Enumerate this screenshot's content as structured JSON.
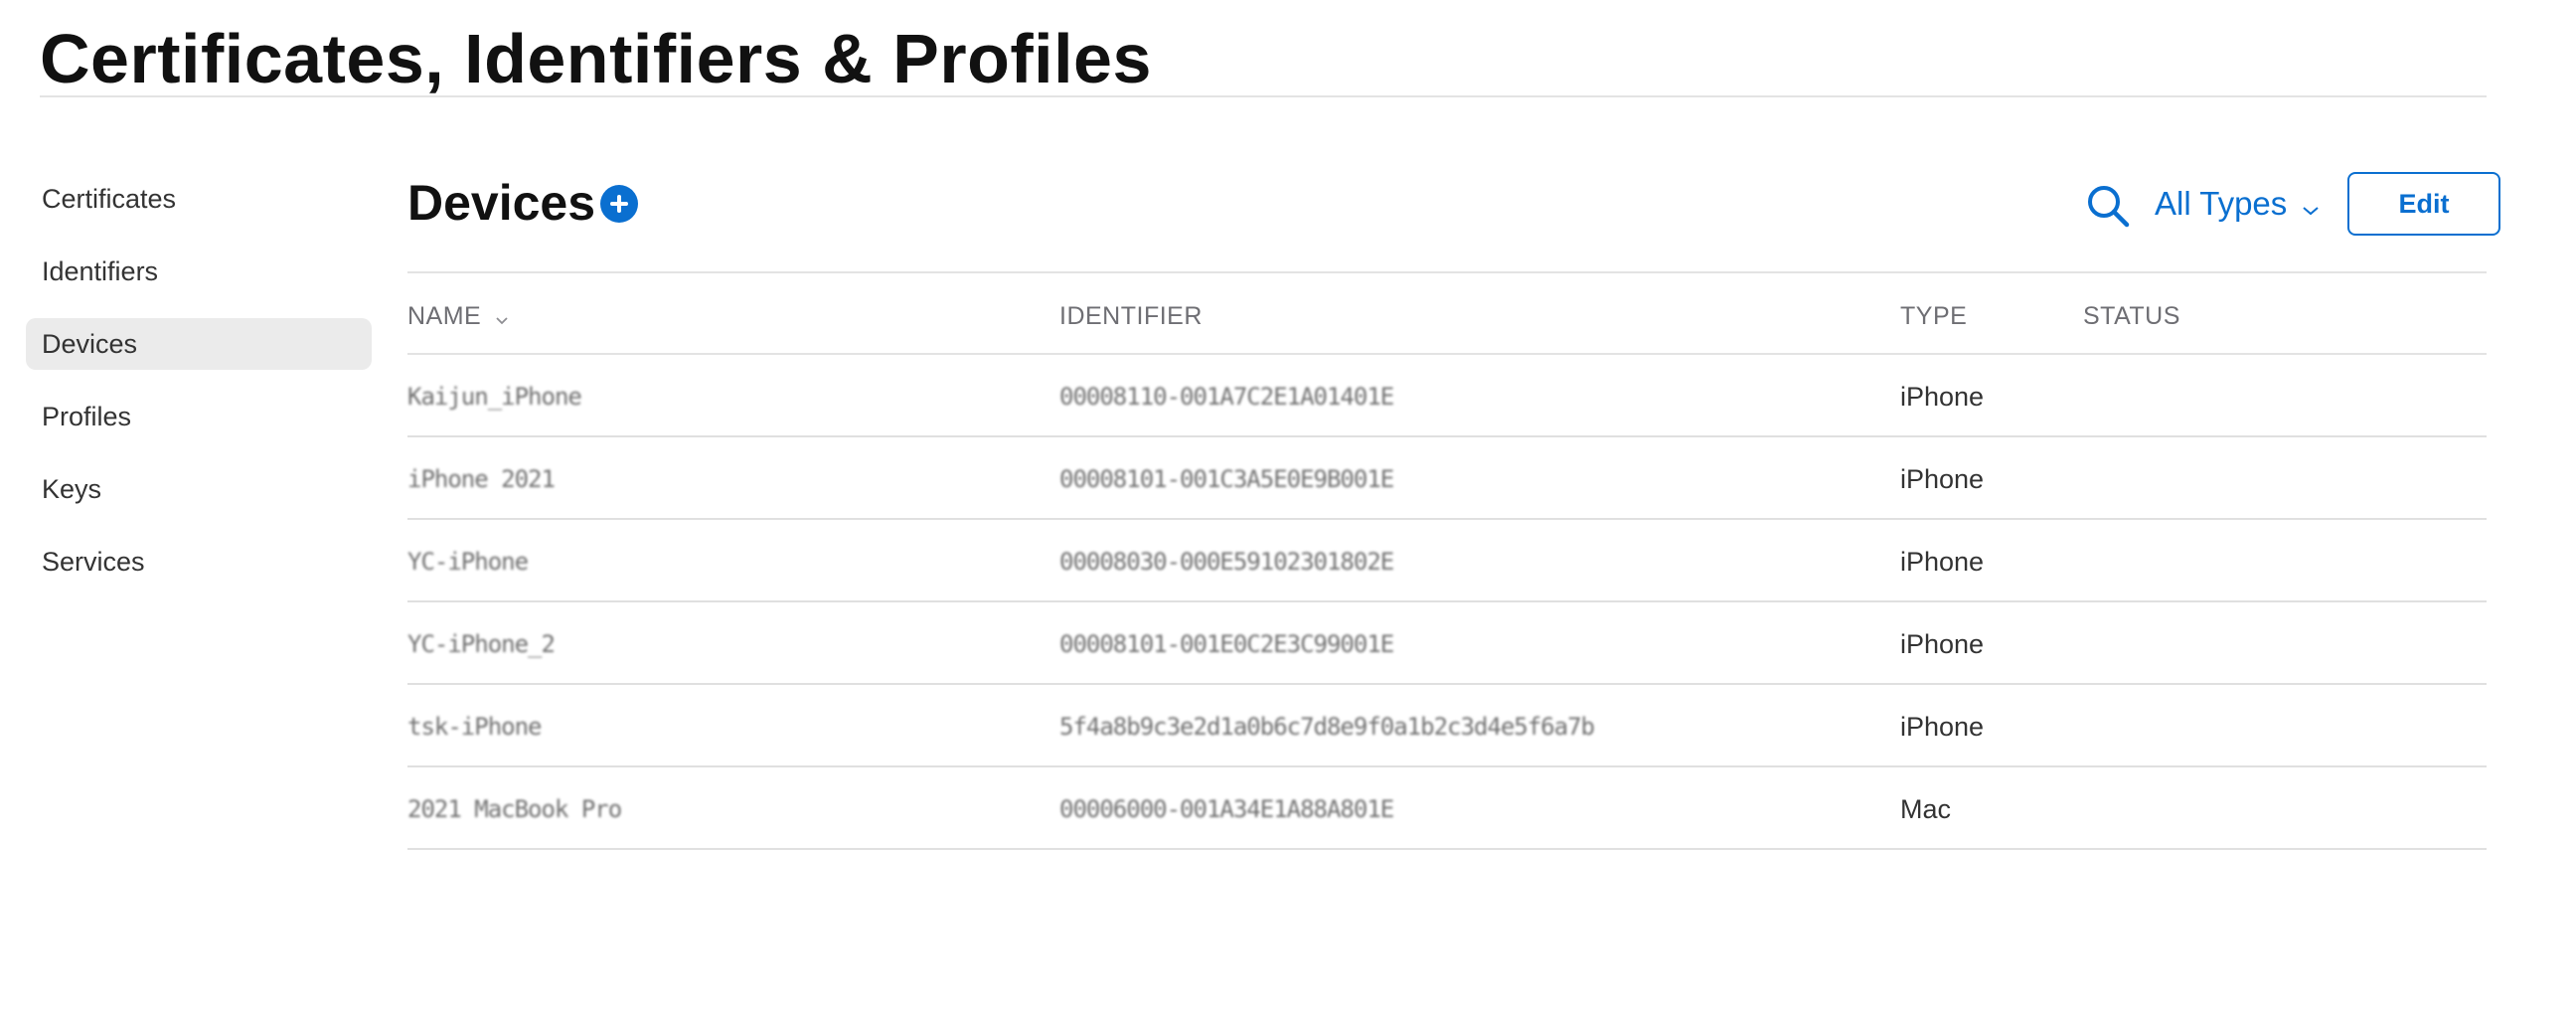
{
  "page": {
    "title": "Certificates, Identifiers & Profiles"
  },
  "sidebar": {
    "items": [
      {
        "label": "Certificates"
      },
      {
        "label": "Identifiers"
      },
      {
        "label": "Devices",
        "active": true
      },
      {
        "label": "Profiles"
      },
      {
        "label": "Keys"
      },
      {
        "label": "Services"
      }
    ]
  },
  "section": {
    "title": "Devices",
    "add_icon": "plus-circle-icon",
    "search_icon": "search-icon",
    "filter_label": "All Types",
    "edit_label": "Edit"
  },
  "table": {
    "columns": {
      "name": "NAME",
      "identifier": "IDENTIFIER",
      "type": "TYPE",
      "status": "STATUS"
    },
    "rows": [
      {
        "name": "Kaijun_iPhone",
        "identifier": "00008110-001A7C2E1A01401E",
        "type": "iPhone",
        "status": ""
      },
      {
        "name": "iPhone 2021",
        "identifier": "00008101-001C3A5E0E9B001E",
        "type": "iPhone",
        "status": ""
      },
      {
        "name": "YC-iPhone",
        "identifier": "00008030-000E59102301802E",
        "type": "iPhone",
        "status": ""
      },
      {
        "name": "YC-iPhone_2",
        "identifier": "00008101-001E0C2E3C99001E",
        "type": "iPhone",
        "status": ""
      },
      {
        "name": "tsk-iPhone",
        "identifier": "5f4a8b9c3e2d1a0b6c7d8e9f0a1b2c3d4e5f6a7b",
        "type": "iPhone",
        "status": ""
      },
      {
        "name": "2021 MacBook Pro",
        "identifier": "00006000-001A34E1A88A801E",
        "type": "Mac",
        "status": ""
      }
    ]
  },
  "colors": {
    "accent": "#0a6fd0",
    "active_bg": "#ebebeb",
    "divider": "#e3e3e3"
  }
}
